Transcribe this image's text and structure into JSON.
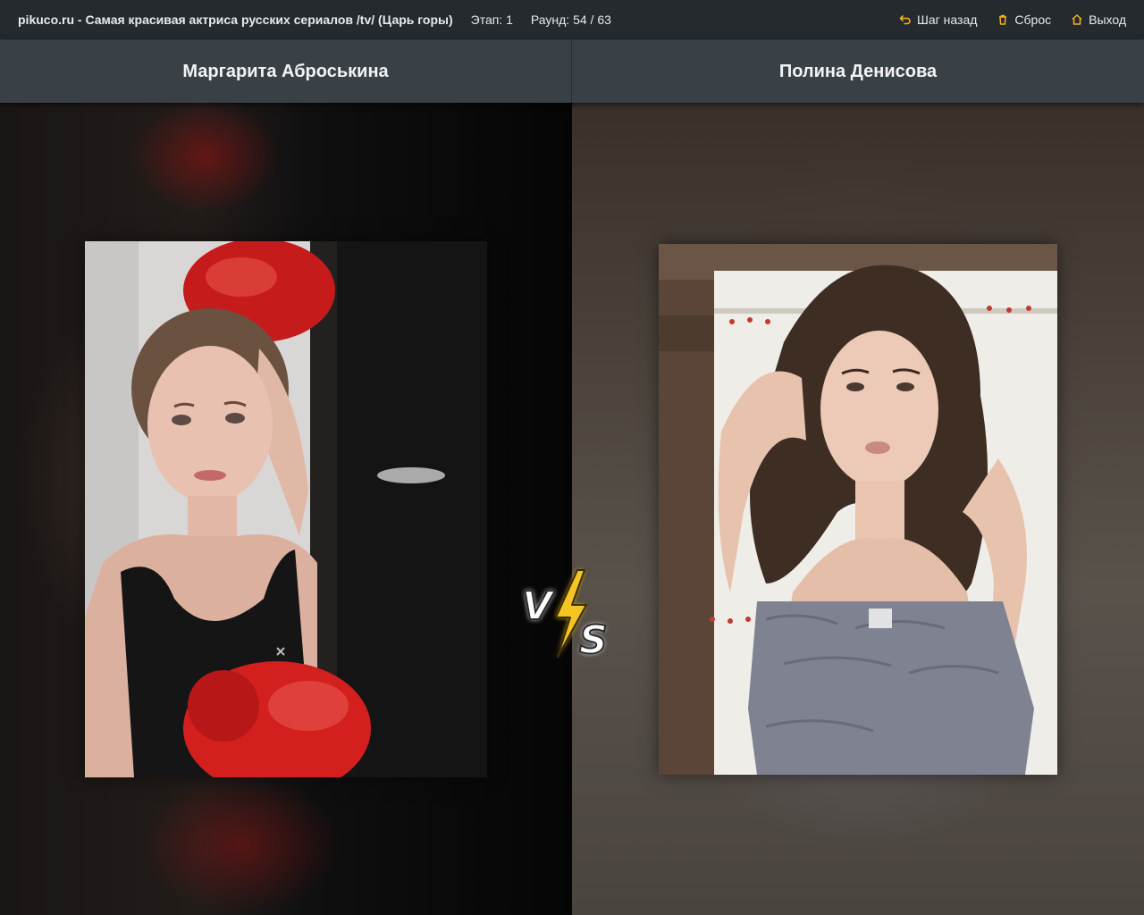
{
  "header": {
    "title": "pikuco.ru - Самая красивая актриса русских сериалов /tv/ (Царь горы)",
    "stage": "Этап: 1",
    "round": "Раунд: 54 / 63",
    "actions": {
      "back": "Шаг назад",
      "reset": "Сброс",
      "exit": "Выход"
    },
    "icons": {
      "back": "undo-arrow-icon",
      "reset": "trash-icon",
      "exit": "home-icon"
    },
    "accent_color": "#f3b51a"
  },
  "contestants": [
    {
      "name": "Маргарита Аброськина"
    },
    {
      "name": "Полина Денисова"
    }
  ],
  "vs_badge": {
    "letters": [
      "V",
      "S"
    ],
    "icon": "lightning-bolt-icon",
    "bolt_color": "#f7c523"
  }
}
